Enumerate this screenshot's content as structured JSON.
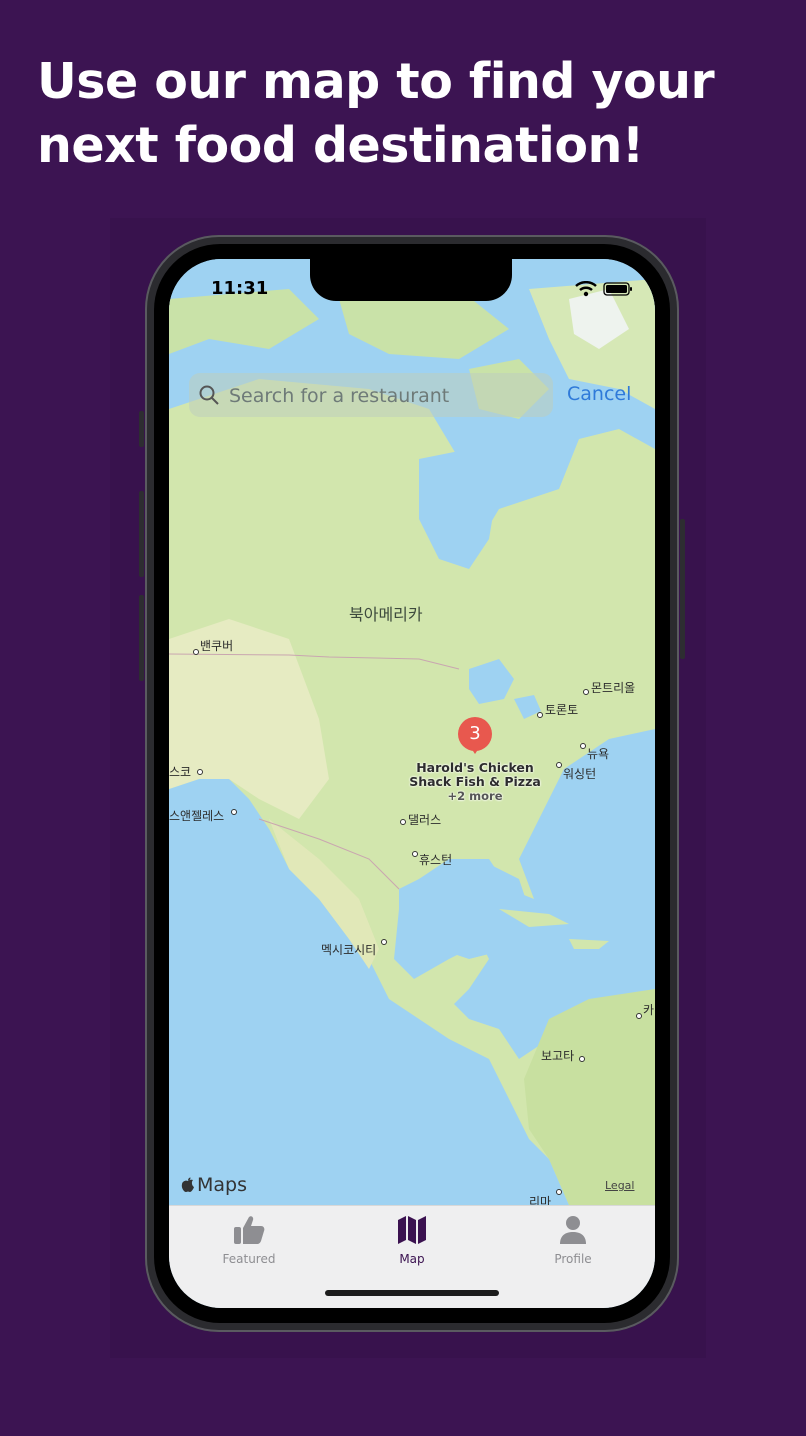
{
  "headline": "Use our map to find your next food destination!",
  "status_bar": {
    "time": "11:31"
  },
  "search": {
    "placeholder": "Search for a restaurant",
    "cancel_label": "Cancel"
  },
  "map": {
    "region_label": "북아메리카",
    "cities": [
      "밴쿠버",
      "토론토",
      "몬트리올",
      "뉴욕",
      "워싱턴",
      "스코",
      "스앤젤레스",
      "댈러스",
      "휴스턴",
      "멕시코시티",
      "보고타",
      "리마",
      "카"
    ],
    "pin_count": "3",
    "cluster_title": "Harold's Chicken Shack Fish & Pizza",
    "cluster_more": "+2 more",
    "attribution": "Maps",
    "legal": "Legal"
  },
  "tabs": [
    {
      "label": "Featured",
      "icon": "thumbs-up-icon",
      "active": false
    },
    {
      "label": "Map",
      "icon": "map-icon",
      "active": true
    },
    {
      "label": "Profile",
      "icon": "person-icon",
      "active": false
    }
  ],
  "colors": {
    "background": "#3c1452",
    "active_tab": "#3b1250",
    "pin": "#e8584e",
    "link": "#2f7ad9"
  }
}
